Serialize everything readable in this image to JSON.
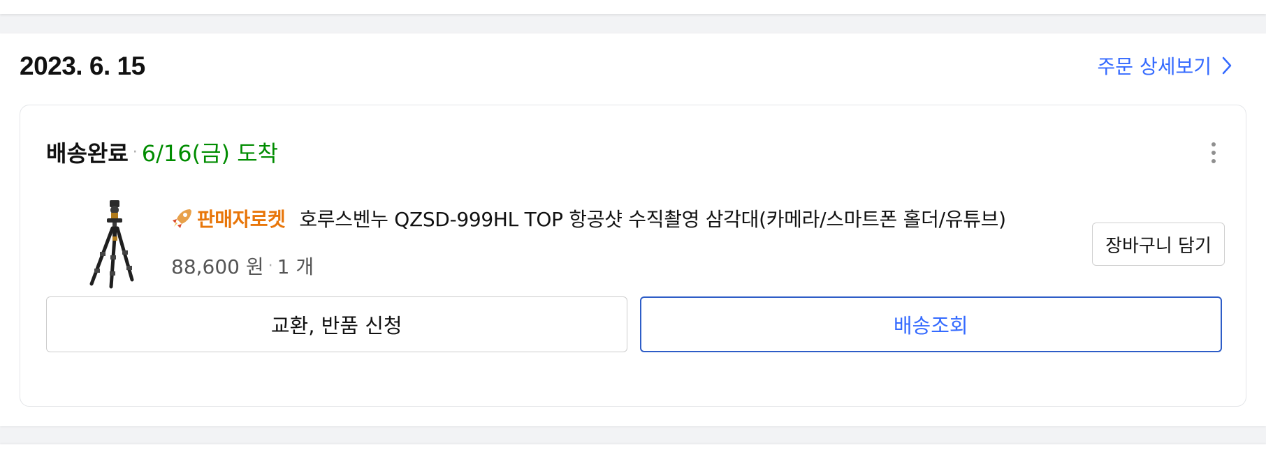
{
  "order": {
    "date": "2023. 6. 15",
    "detail_link_label": "주문 상세보기"
  },
  "shipment": {
    "status": "배송완료",
    "separator": "·",
    "arrival": "6/16(금) 도착"
  },
  "product": {
    "badge_label": "판매자로켓",
    "badge_icon": "rocket-icon",
    "title": "호루스벤누 QZSD-999HL TOP 항공샷 수직촬영 삼각대(카메라/스마트폰 홀더/유튜브)",
    "price": "88,600 원",
    "quantity": "1 개",
    "thumbnail_icon": "tripod-image"
  },
  "actions": {
    "add_to_cart": "장바구니 담기",
    "exchange_return": "교환, 반품 신청",
    "track_delivery": "배송조회",
    "more_icon": "more-vertical-icon"
  },
  "colors": {
    "accent_blue": "#346aff",
    "status_green": "#008c00",
    "rocket_orange": "#e8760a"
  }
}
